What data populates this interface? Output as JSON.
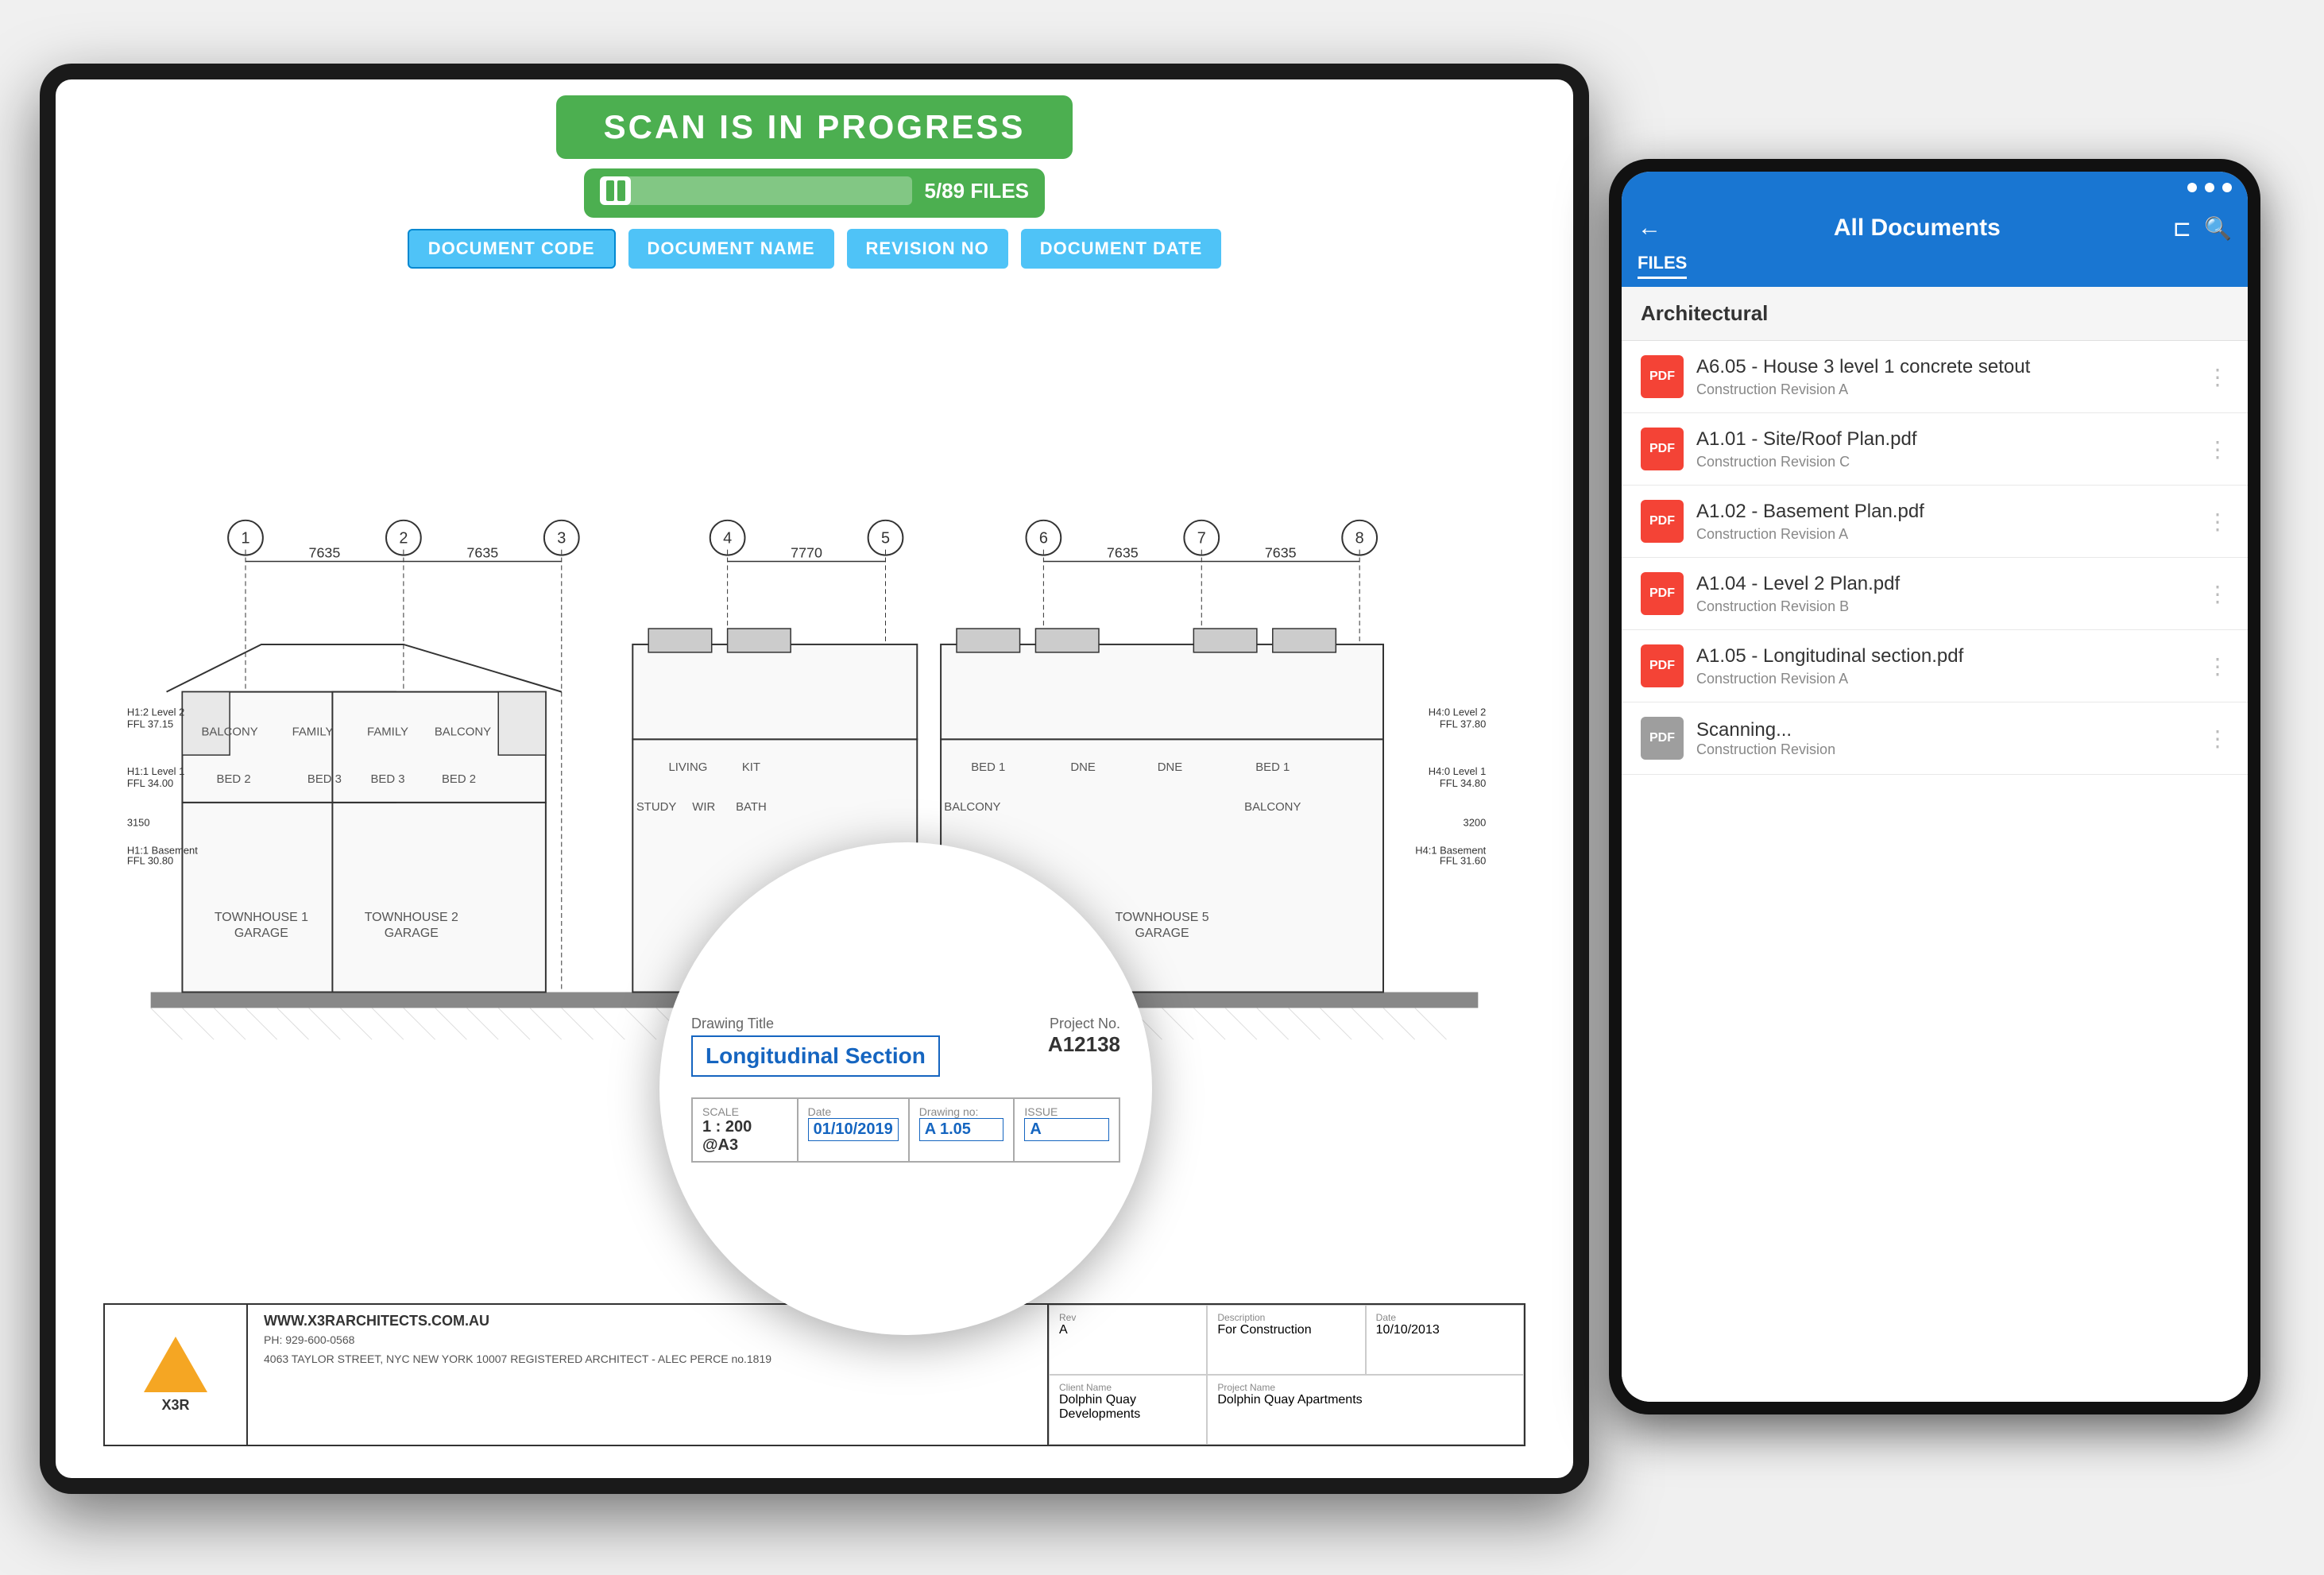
{
  "scan": {
    "title": "SCAN IS IN PROGRESS",
    "progress_text": "5/89 FILES",
    "progress_percent": 10
  },
  "column_headers": [
    {
      "label": "DOCUMENT CODE",
      "active": true
    },
    {
      "label": "DOCUMENT NAME",
      "active": false
    },
    {
      "label": "REVISION NO",
      "active": false
    },
    {
      "label": "DOCUMENT DATE",
      "active": false
    }
  ],
  "title_block": {
    "website": "WWW.X3RARCHITECTS.COM.AU",
    "phone": "PH: 929-600-0568",
    "address": "4063 TAYLOR STREET, NYC\nNEW YORK 10007\nREGISTERED ARCHITECT - ALEC PERCE no.1819",
    "rev_label": "Rev",
    "rev_value": "A",
    "desc_label": "Description",
    "desc_value": "For Construction",
    "date_label": "Date",
    "date_value": "10/10/2013",
    "client_label": "Client Name",
    "client_value": "Dolphin Quay Developments",
    "project_label": "Project Name",
    "project_value": "Dolphin Quay Apartments"
  },
  "zoom": {
    "drawing_title_label": "Drawing Title",
    "drawing_title": "Longitudinal Section",
    "project_no_label": "Project No.",
    "project_no": "A12138",
    "scale_label": "SCALE",
    "scale_value": "1 : 200 @A3",
    "date_label": "Date",
    "date_value": "01/10/2019",
    "drawing_no_label": "Drawing no:",
    "drawing_no_value": "A 1.05",
    "issue_label": "ISSUE",
    "issue_value": "A"
  },
  "phone": {
    "back_icon": "←",
    "title": "All Documents",
    "share_icon": "⊏",
    "search_icon": "🔍",
    "tab": "FILES",
    "section": "Architectural",
    "documents": [
      {
        "code": "A6.05",
        "name": "A6.05 - House 3 level 1 concrete setout",
        "subtitle": "Construction Revision A"
      },
      {
        "code": "A1.01",
        "name": "A1.01 - Site/Roof Plan.pdf",
        "subtitle": "Construction Revision C"
      },
      {
        "code": "A1.02",
        "name": "A1.02 - Basement Plan.pdf",
        "subtitle": "Construction Revision A"
      },
      {
        "code": "A1.04",
        "name": "A1.04 - Level 2 Plan.pdf",
        "subtitle": "Construction Revision B"
      },
      {
        "code": "A1.05",
        "name": "A1.05 - Longitudinal section.pdf",
        "subtitle": "Construction Revision A"
      }
    ],
    "scanning_name": "Scanning...",
    "scanning_subtitle": "Construction Revision"
  }
}
